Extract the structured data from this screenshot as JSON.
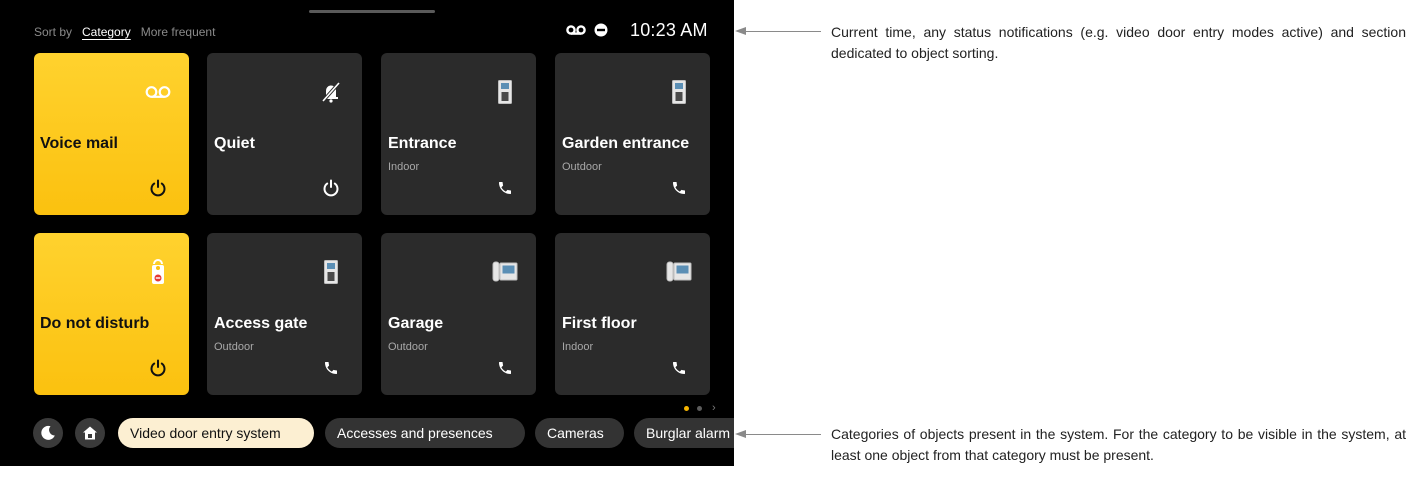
{
  "sort": {
    "label": "Sort by",
    "options": [
      "Category",
      "More frequent"
    ]
  },
  "status": {
    "time": "10:23 AM",
    "icons": [
      "voicemail-icon",
      "do-not-disturb-icon"
    ]
  },
  "tiles": [
    {
      "name": "Voice mail",
      "subtitle": "",
      "icon": "voicemail-icon",
      "action": "power-icon",
      "style": "yellow"
    },
    {
      "name": "Quiet",
      "subtitle": "",
      "icon": "bell-off-icon",
      "action": "power-icon",
      "style": "dark"
    },
    {
      "name": "Entrance",
      "subtitle": "Indoor",
      "icon": "door-entry-panel-icon",
      "action": "phone-icon",
      "style": "dark"
    },
    {
      "name": "Garden entrance",
      "subtitle": "Outdoor",
      "icon": "door-entry-panel-icon",
      "action": "phone-icon",
      "style": "dark"
    },
    {
      "name": "Do not disturb",
      "subtitle": "",
      "icon": "do-not-disturb-hanger-icon",
      "action": "power-icon",
      "style": "yellow"
    },
    {
      "name": "Access gate",
      "subtitle": "Outdoor",
      "icon": "door-entry-panel-icon",
      "action": "phone-icon",
      "style": "dark"
    },
    {
      "name": "Garage",
      "subtitle": "Outdoor",
      "icon": "intercom-handset-icon",
      "action": "phone-icon",
      "style": "dark"
    },
    {
      "name": "First floor",
      "subtitle": "Indoor",
      "icon": "intercom-handset-icon",
      "action": "phone-icon",
      "style": "dark"
    }
  ],
  "pagination": {
    "pages": 2,
    "current": 1
  },
  "categories": {
    "shortcuts": [
      "night-mode-icon",
      "home-away-icon"
    ],
    "items": [
      "Video door entry system",
      "Accesses and presences",
      "Cameras",
      "Burglar alarm"
    ],
    "selected": 0
  },
  "callouts": {
    "top": "Current time, any status notifications (e.g. video door entry modes active) and section dedicated to object sorting.",
    "bottom": "Categories of objects present in the system. For the category to be visible in the system, at least one object from that category must be present."
  },
  "colors": {
    "accent": "#FBC10F",
    "tile_dark": "#2B2B2B",
    "chip_selected": "#FCEFD2",
    "screen_bg": "#000000"
  }
}
